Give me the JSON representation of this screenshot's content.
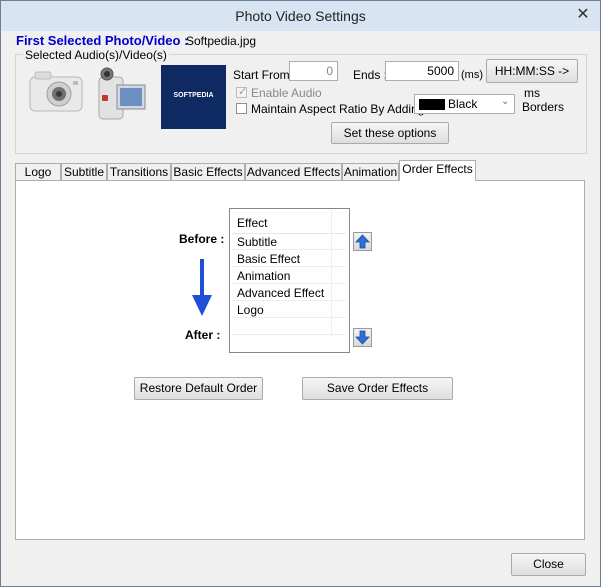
{
  "window": {
    "title": "Photo Video Settings",
    "close_symbol": "✕"
  },
  "header": {
    "first_selected_label": "First Selected Photo/Video :",
    "first_selected_value": "Softpedia.jpg",
    "selected_media_label": "Selected Audio(s)/Video(s)",
    "thumbnail_text": "SOFTPEDIA"
  },
  "options": {
    "start_from_label": "Start From :",
    "start_from_value": "0",
    "ends_label": "Ends :",
    "ends_value": "5000",
    "ms_unit": "(ms)",
    "time_convert_button": "HH:MM:SS -> ms",
    "enable_audio_label": "Enable Audio",
    "enable_audio_checked": true,
    "maintain_aspect_label": "Maintain Aspect Ratio By Adding",
    "maintain_aspect_checked": false,
    "border_color_name": "Black",
    "border_color_hex": "#000000",
    "borders_label": "Borders",
    "set_options_button": "Set these options"
  },
  "tabs": [
    {
      "label": "Logo"
    },
    {
      "label": "Subtitle"
    },
    {
      "label": "Transitions"
    },
    {
      "label": "Basic Effects"
    },
    {
      "label": "Advanced Effects"
    },
    {
      "label": "Animation"
    },
    {
      "label": "Order Effects",
      "active": true
    }
  ],
  "order_effects": {
    "before_label": "Before :",
    "after_label": "After :",
    "column_header": "Effect",
    "effects": [
      "Subtitle",
      "Basic Effect",
      "Animation",
      "Advanced Effect",
      "Logo"
    ],
    "restore_button": "Restore Default Order",
    "save_button": "Save Order Effects"
  },
  "footer": {
    "close_button": "Close"
  },
  "colors": {
    "accent_blue": "#0000cc",
    "arrow_blue": "#1f4fd6"
  }
}
